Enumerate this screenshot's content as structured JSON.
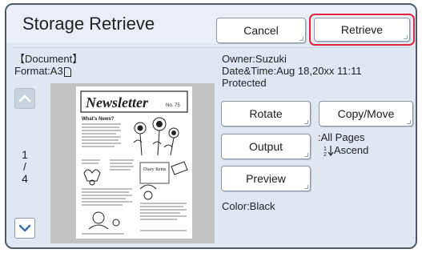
{
  "header": {
    "title": "Storage Retrieve",
    "cancel_label": "Cancel",
    "retrieve_label": "Retrieve"
  },
  "document": {
    "heading": "【Document】",
    "format_label": "Format:A3"
  },
  "meta": {
    "owner": "Owner:Suzuki",
    "datetime": "Date&Time:Aug 18,20xx 11:11",
    "status": "Protected"
  },
  "pager": {
    "current": "1",
    "separator": "/",
    "total": "4"
  },
  "preview": {
    "newsletter_title": "Newsletter",
    "issue": "No. 75",
    "news_heading": "What's News?",
    "diary_label": "Diary Items"
  },
  "actions": {
    "rotate_label": "Rotate",
    "copy_move_label": "Copy/Move",
    "output_label": "Output",
    "preview_label": "Preview"
  },
  "output_settings": {
    "pages": ":All Pages",
    "order": "Ascend"
  },
  "color_mode": "Color:Black",
  "icons": {
    "scroll_up": "chevron-up-icon",
    "scroll_down": "chevron-down-icon",
    "format": "paper-icon",
    "order": "sort-ascend-icon"
  },
  "colors": {
    "accent_ring": "#e0253e",
    "panel_bg": "#dfe7f3",
    "chevron_active": "#3d6ea3"
  }
}
